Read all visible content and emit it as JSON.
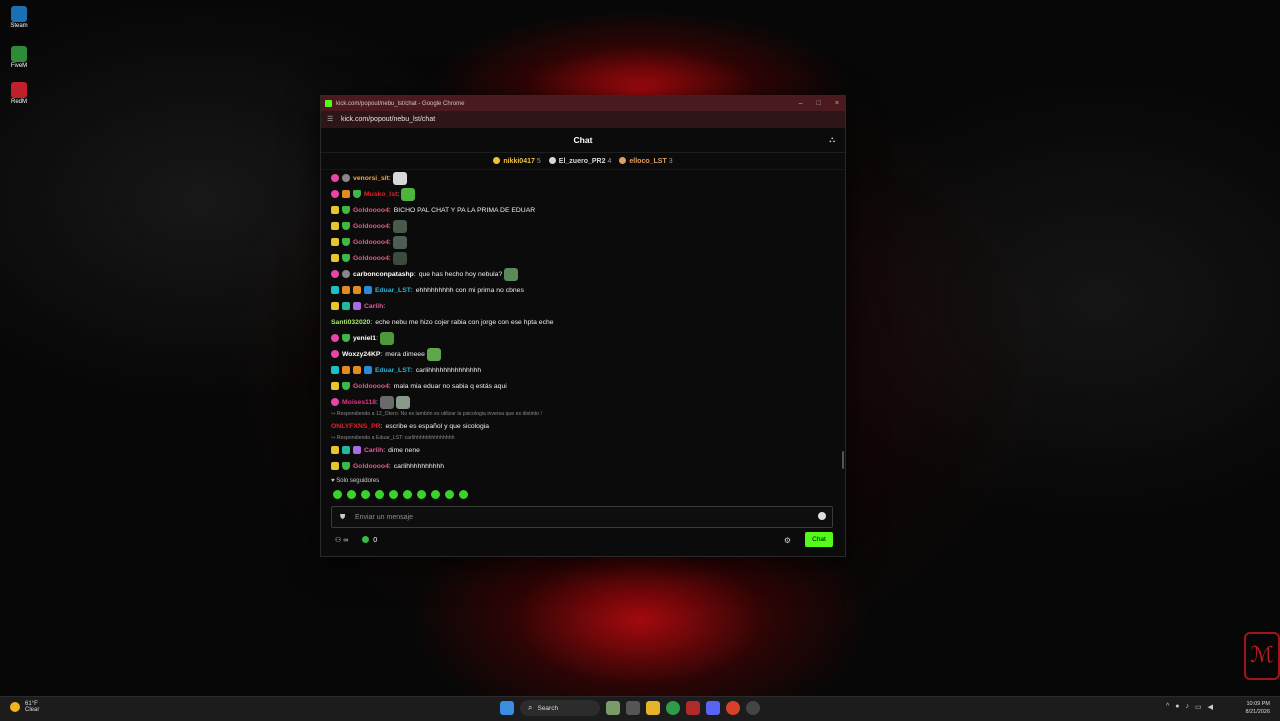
{
  "desktop": {
    "icons": [
      {
        "label": "Steam",
        "icon": "steam-icon",
        "color": "#1b6fb3"
      },
      {
        "label": "FiveM",
        "icon": "fivem-icon",
        "color": "#2e8b3a"
      },
      {
        "label": "RedM",
        "icon": "redm-icon",
        "color": "#c0202a"
      }
    ]
  },
  "window": {
    "title": "kick.com/popout/nebu_lst/chat - Google Chrome",
    "url": "kick.com/popout/nebu_lst/chat",
    "controls": [
      "–",
      "□",
      "×"
    ]
  },
  "chat": {
    "header": "Chat",
    "pinned": [
      {
        "name": "nikki0417",
        "count": "5",
        "color": "#f0c23a"
      },
      {
        "name": "El_zuero_PR2",
        "count": "4",
        "color": "#d8d8d8"
      },
      {
        "name": "elloco_LST",
        "count": "3",
        "color": "#e0a060"
      }
    ],
    "messages": [
      {
        "type": "msg",
        "badges": [
          "b-pink",
          "b-gray"
        ],
        "user": "venorsi_slt",
        "color": "#f0a83a",
        "text": "",
        "emotes": [
          "#d8d8d8"
        ]
      },
      {
        "type": "msg",
        "badges": [
          "b-pink",
          "b-orange",
          "b-green"
        ],
        "user": "Musko_lst",
        "color": "#e8202a",
        "text": "",
        "emotes": [
          "#4fb43c"
        ]
      },
      {
        "type": "msg",
        "badges": [
          "b-yellow",
          "b-green"
        ],
        "user": "Goldoooo4",
        "color": "#e85a7a",
        "text": "BICHO PAL CHAT Y PA LA PRIMA DE EDUAR",
        "emotes": []
      },
      {
        "type": "msg",
        "badges": [
          "b-yellow",
          "b-green"
        ],
        "user": "Goldoooo4",
        "color": "#e85a7a",
        "text": "",
        "emotes": [
          "#4a5a4a"
        ]
      },
      {
        "type": "msg",
        "badges": [
          "b-yellow",
          "b-green"
        ],
        "user": "Goldoooo4",
        "color": "#e85a7a",
        "text": "",
        "emotes": [
          "#4e5e56"
        ]
      },
      {
        "type": "msg",
        "badges": [
          "b-yellow",
          "b-green"
        ],
        "user": "Goldoooo4",
        "color": "#e85a7a",
        "text": "",
        "emotes": [
          "#3d4a3e"
        ]
      },
      {
        "type": "msg",
        "badges": [
          "b-pink",
          "b-gray"
        ],
        "user": "carbonconpatashp",
        "color": "#ffffff",
        "text": "que has hecho hoy nebula?",
        "emotes": [
          "#5a8a5a"
        ]
      },
      {
        "type": "msg",
        "badges": [
          "b-cyan",
          "b-orange",
          "b-orange",
          "b-blue"
        ],
        "user": "Eduar_LST",
        "color": "#2ab6d8",
        "text": "ehhhhhhhhh con mi prima no cbnes",
        "emotes": []
      },
      {
        "type": "msg",
        "badges": [
          "b-yellow",
          "b-teal",
          "b-purple"
        ],
        "user": "Carlih",
        "color": "#e85a9a",
        "text": "",
        "emotes": []
      },
      {
        "type": "msg",
        "badges": [],
        "user": "Santi032020",
        "color": "#a8e86a",
        "text": "eche nebu me hizo cojer rabia con jorge con ese hpta eche",
        "emotes": []
      },
      {
        "type": "msg",
        "badges": [
          "b-pink",
          "b-green"
        ],
        "user": "yeniel1",
        "color": "#ffffff",
        "text": "",
        "emotes": [
          "#4c9a3a"
        ]
      },
      {
        "type": "msg",
        "badges": [
          "b-pink"
        ],
        "user": "Woxzy24KP",
        "color": "#ffffff",
        "text": "mera dimeee",
        "emotes": [
          "#5ea84a"
        ]
      },
      {
        "type": "msg",
        "badges": [
          "b-cyan",
          "b-orange",
          "b-orange",
          "b-blue"
        ],
        "user": "Eduar_LST",
        "color": "#2ab6d8",
        "text": "carlihhhhhhhhhhhhhh",
        "emotes": []
      },
      {
        "type": "msg",
        "badges": [
          "b-yellow",
          "b-green"
        ],
        "user": "Goldoooo4",
        "color": "#e85a7a",
        "text": "mala mia eduar no sabia q estás aqui",
        "emotes": []
      },
      {
        "type": "msg",
        "badges": [
          "b-pink"
        ],
        "user": "Moises118",
        "color": "#e8328a",
        "text": "",
        "emotes": [
          "#6a6a6a",
          "#8a9a8a"
        ]
      },
      {
        "type": "reply",
        "text": "↪ Respondiendo a 12_Otero: No es lambón es utilizar la psicologia inversa que es distinto !"
      },
      {
        "type": "msg",
        "badges": [],
        "user": "ONLYFXNS_PR",
        "color": "#e8202a",
        "text": "escribe es español y que sicologia",
        "emotes": []
      },
      {
        "type": "reply",
        "text": "↪ Respondiendo a Eduar_LST: carlihhhhhhhhhhhhhh"
      },
      {
        "type": "msg",
        "badges": [
          "b-yellow",
          "b-teal",
          "b-purple"
        ],
        "user": "Carlih",
        "color": "#e85a9a",
        "text": "dime nene",
        "emotes": []
      },
      {
        "type": "msg",
        "badges": [
          "b-yellow",
          "b-green"
        ],
        "user": "Goldoooo4",
        "color": "#e85a7a",
        "text": "carlihhhhhhhhhh",
        "emotes": []
      }
    ],
    "followers_only": "Solo seguidores",
    "input_placeholder": "Enviar un mensaje",
    "infinity": "∞",
    "points": "0",
    "chat_button": "Chat",
    "accent": "#53fc18"
  },
  "taskbar": {
    "weather_temp": "61°F",
    "weather_desc": "Clear",
    "search_label": "Search",
    "time": "10:09 PM",
    "date": "8/21/2026"
  }
}
